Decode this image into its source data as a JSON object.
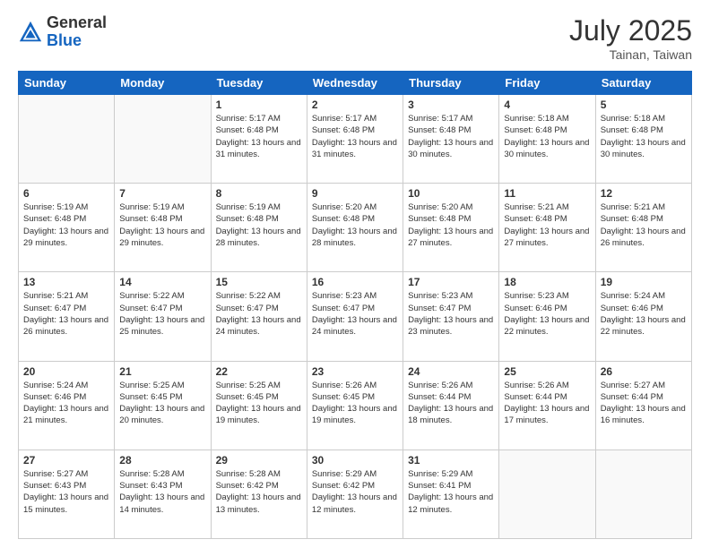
{
  "logo": {
    "general": "General",
    "blue": "Blue"
  },
  "header": {
    "month": "July 2025",
    "location": "Tainan, Taiwan"
  },
  "weekdays": [
    "Sunday",
    "Monday",
    "Tuesday",
    "Wednesday",
    "Thursday",
    "Friday",
    "Saturday"
  ],
  "weeks": [
    [
      {
        "day": "",
        "info": ""
      },
      {
        "day": "",
        "info": ""
      },
      {
        "day": "1",
        "info": "Sunrise: 5:17 AM\nSunset: 6:48 PM\nDaylight: 13 hours and 31 minutes."
      },
      {
        "day": "2",
        "info": "Sunrise: 5:17 AM\nSunset: 6:48 PM\nDaylight: 13 hours and 31 minutes."
      },
      {
        "day": "3",
        "info": "Sunrise: 5:17 AM\nSunset: 6:48 PM\nDaylight: 13 hours and 30 minutes."
      },
      {
        "day": "4",
        "info": "Sunrise: 5:18 AM\nSunset: 6:48 PM\nDaylight: 13 hours and 30 minutes."
      },
      {
        "day": "5",
        "info": "Sunrise: 5:18 AM\nSunset: 6:48 PM\nDaylight: 13 hours and 30 minutes."
      }
    ],
    [
      {
        "day": "6",
        "info": "Sunrise: 5:19 AM\nSunset: 6:48 PM\nDaylight: 13 hours and 29 minutes."
      },
      {
        "day": "7",
        "info": "Sunrise: 5:19 AM\nSunset: 6:48 PM\nDaylight: 13 hours and 29 minutes."
      },
      {
        "day": "8",
        "info": "Sunrise: 5:19 AM\nSunset: 6:48 PM\nDaylight: 13 hours and 28 minutes."
      },
      {
        "day": "9",
        "info": "Sunrise: 5:20 AM\nSunset: 6:48 PM\nDaylight: 13 hours and 28 minutes."
      },
      {
        "day": "10",
        "info": "Sunrise: 5:20 AM\nSunset: 6:48 PM\nDaylight: 13 hours and 27 minutes."
      },
      {
        "day": "11",
        "info": "Sunrise: 5:21 AM\nSunset: 6:48 PM\nDaylight: 13 hours and 27 minutes."
      },
      {
        "day": "12",
        "info": "Sunrise: 5:21 AM\nSunset: 6:48 PM\nDaylight: 13 hours and 26 minutes."
      }
    ],
    [
      {
        "day": "13",
        "info": "Sunrise: 5:21 AM\nSunset: 6:47 PM\nDaylight: 13 hours and 26 minutes."
      },
      {
        "day": "14",
        "info": "Sunrise: 5:22 AM\nSunset: 6:47 PM\nDaylight: 13 hours and 25 minutes."
      },
      {
        "day": "15",
        "info": "Sunrise: 5:22 AM\nSunset: 6:47 PM\nDaylight: 13 hours and 24 minutes."
      },
      {
        "day": "16",
        "info": "Sunrise: 5:23 AM\nSunset: 6:47 PM\nDaylight: 13 hours and 24 minutes."
      },
      {
        "day": "17",
        "info": "Sunrise: 5:23 AM\nSunset: 6:47 PM\nDaylight: 13 hours and 23 minutes."
      },
      {
        "day": "18",
        "info": "Sunrise: 5:23 AM\nSunset: 6:46 PM\nDaylight: 13 hours and 22 minutes."
      },
      {
        "day": "19",
        "info": "Sunrise: 5:24 AM\nSunset: 6:46 PM\nDaylight: 13 hours and 22 minutes."
      }
    ],
    [
      {
        "day": "20",
        "info": "Sunrise: 5:24 AM\nSunset: 6:46 PM\nDaylight: 13 hours and 21 minutes."
      },
      {
        "day": "21",
        "info": "Sunrise: 5:25 AM\nSunset: 6:45 PM\nDaylight: 13 hours and 20 minutes."
      },
      {
        "day": "22",
        "info": "Sunrise: 5:25 AM\nSunset: 6:45 PM\nDaylight: 13 hours and 19 minutes."
      },
      {
        "day": "23",
        "info": "Sunrise: 5:26 AM\nSunset: 6:45 PM\nDaylight: 13 hours and 19 minutes."
      },
      {
        "day": "24",
        "info": "Sunrise: 5:26 AM\nSunset: 6:44 PM\nDaylight: 13 hours and 18 minutes."
      },
      {
        "day": "25",
        "info": "Sunrise: 5:26 AM\nSunset: 6:44 PM\nDaylight: 13 hours and 17 minutes."
      },
      {
        "day": "26",
        "info": "Sunrise: 5:27 AM\nSunset: 6:44 PM\nDaylight: 13 hours and 16 minutes."
      }
    ],
    [
      {
        "day": "27",
        "info": "Sunrise: 5:27 AM\nSunset: 6:43 PM\nDaylight: 13 hours and 15 minutes."
      },
      {
        "day": "28",
        "info": "Sunrise: 5:28 AM\nSunset: 6:43 PM\nDaylight: 13 hours and 14 minutes."
      },
      {
        "day": "29",
        "info": "Sunrise: 5:28 AM\nSunset: 6:42 PM\nDaylight: 13 hours and 13 minutes."
      },
      {
        "day": "30",
        "info": "Sunrise: 5:29 AM\nSunset: 6:42 PM\nDaylight: 13 hours and 12 minutes."
      },
      {
        "day": "31",
        "info": "Sunrise: 5:29 AM\nSunset: 6:41 PM\nDaylight: 13 hours and 12 minutes."
      },
      {
        "day": "",
        "info": ""
      },
      {
        "day": "",
        "info": ""
      }
    ]
  ]
}
